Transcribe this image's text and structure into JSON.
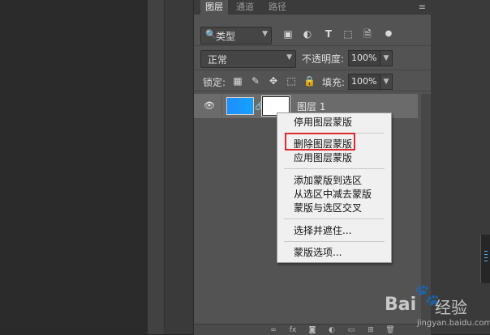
{
  "tabs": [
    "图层",
    "通道",
    "路径"
  ],
  "tab_menu_icon": "menu-icon",
  "filter": {
    "search_glyph": "🔍",
    "kind_label": "类型",
    "icons": [
      "image-filter-icon",
      "adjustment-filter-icon",
      "text-filter-icon",
      "shape-filter-icon",
      "smart-object-filter-icon",
      "filter-toggle-icon"
    ],
    "glyphs": [
      "▣",
      "◐",
      "T",
      "⬚",
      "🗎",
      "●"
    ]
  },
  "blend": {
    "mode": "正常",
    "opacity_label": "不透明度:",
    "opacity_value": "100%"
  },
  "lock": {
    "label": "锁定:",
    "icons": [
      "lock-transparent-icon",
      "lock-image-icon",
      "lock-position-icon",
      "lock-artboard-icon",
      "lock-all-icon"
    ],
    "glyphs": [
      "▦",
      "✎",
      "✥",
      "⬚",
      "🔒"
    ],
    "fill_label": "填充:",
    "fill_value": "100%"
  },
  "layer": {
    "name": "图层 1",
    "thumb_color": "#1e8fff"
  },
  "context_menu": {
    "items": [
      "停用图层蒙版",
      "删除图层蒙版",
      "应用图层蒙版",
      "添加蒙版到选区",
      "从选区中减去蒙版",
      "蒙版与选区交叉",
      "选择并遮住...",
      "蒙版选项..."
    ],
    "highlighted": "删除图层蒙版",
    "highlight_color": "#e0282f"
  },
  "watermark": {
    "logo": "Bai",
    "cn": "经验",
    "url": "jingyan.baidu.com"
  }
}
